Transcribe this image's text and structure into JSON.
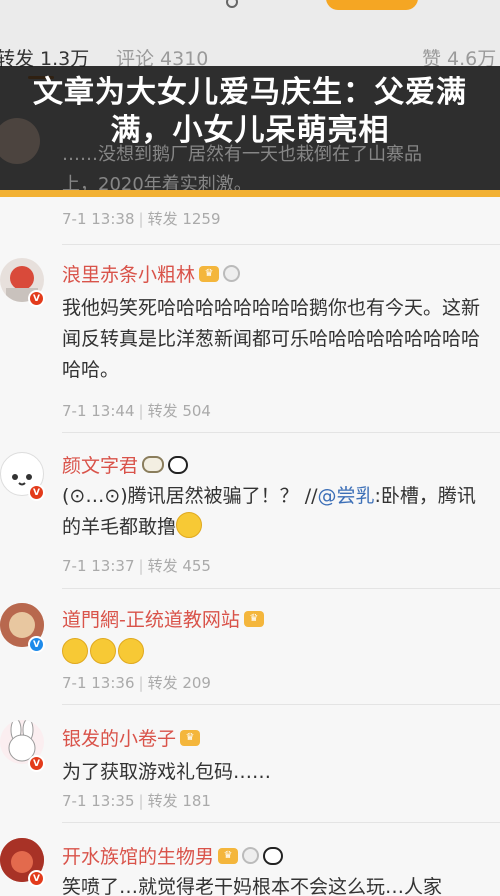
{
  "tabs": {
    "repost": "转发 1.3万",
    "comment": "评论 4310",
    "like": "赞 4.6万"
  },
  "banner": {
    "title": "文章为大女儿爱马庆生：父爱满满，小女儿呆萌亮相",
    "under_text_1": "……没想到鹅厂居然有一天也栽倒在了山寨品",
    "under_text_2": "上，2020年着实刺激。"
  },
  "top_meta": {
    "time": "7-1 13:38",
    "repost": "转发 1259"
  },
  "posts": [
    {
      "name": "浪里赤条小粗林",
      "text": "我他妈笑死哈哈哈哈哈哈哈哈鹅你也有今天。这新闻反转真是比洋葱新闻都可乐哈哈哈哈哈哈哈哈哈哈哈。",
      "time": "7-1 13:44",
      "repost": "转发 504"
    },
    {
      "name": "颜文字君",
      "text_before": "(⊙…⊙)腾讯居然被骗了！？ //",
      "mention": "@尝乳",
      "text_after": ":卧槽，腾讯的羊毛都敢撸",
      "time": "7-1 13:37",
      "repost": "转发 455"
    },
    {
      "name": "道門網-正统道教网站",
      "text": "",
      "time": "7-1 13:36",
      "repost": "转发 209"
    },
    {
      "name": "银发的小卷子",
      "text": "为了获取游戏礼包码……",
      "time": "7-1 13:35",
      "repost": "转发 181"
    },
    {
      "name": "开水族馆的生物男",
      "text": "笑喷了…就觉得老干妈根本不会这么玩…人家",
      "time": "",
      "repost": ""
    }
  ],
  "icons": {
    "verified_red": "v-badge-red",
    "verified_blue": "v-badge-blue",
    "crown": "crown-icon",
    "medal": "medal-icon",
    "panda": "panda-icon",
    "sheep": "sheep-icon",
    "emoji": "grin-emoji-icon"
  },
  "colors": {
    "accent": "#f08a1c",
    "username": "#d9534a",
    "mention": "#3c6fb7",
    "banner_rule": "#f2b134"
  }
}
